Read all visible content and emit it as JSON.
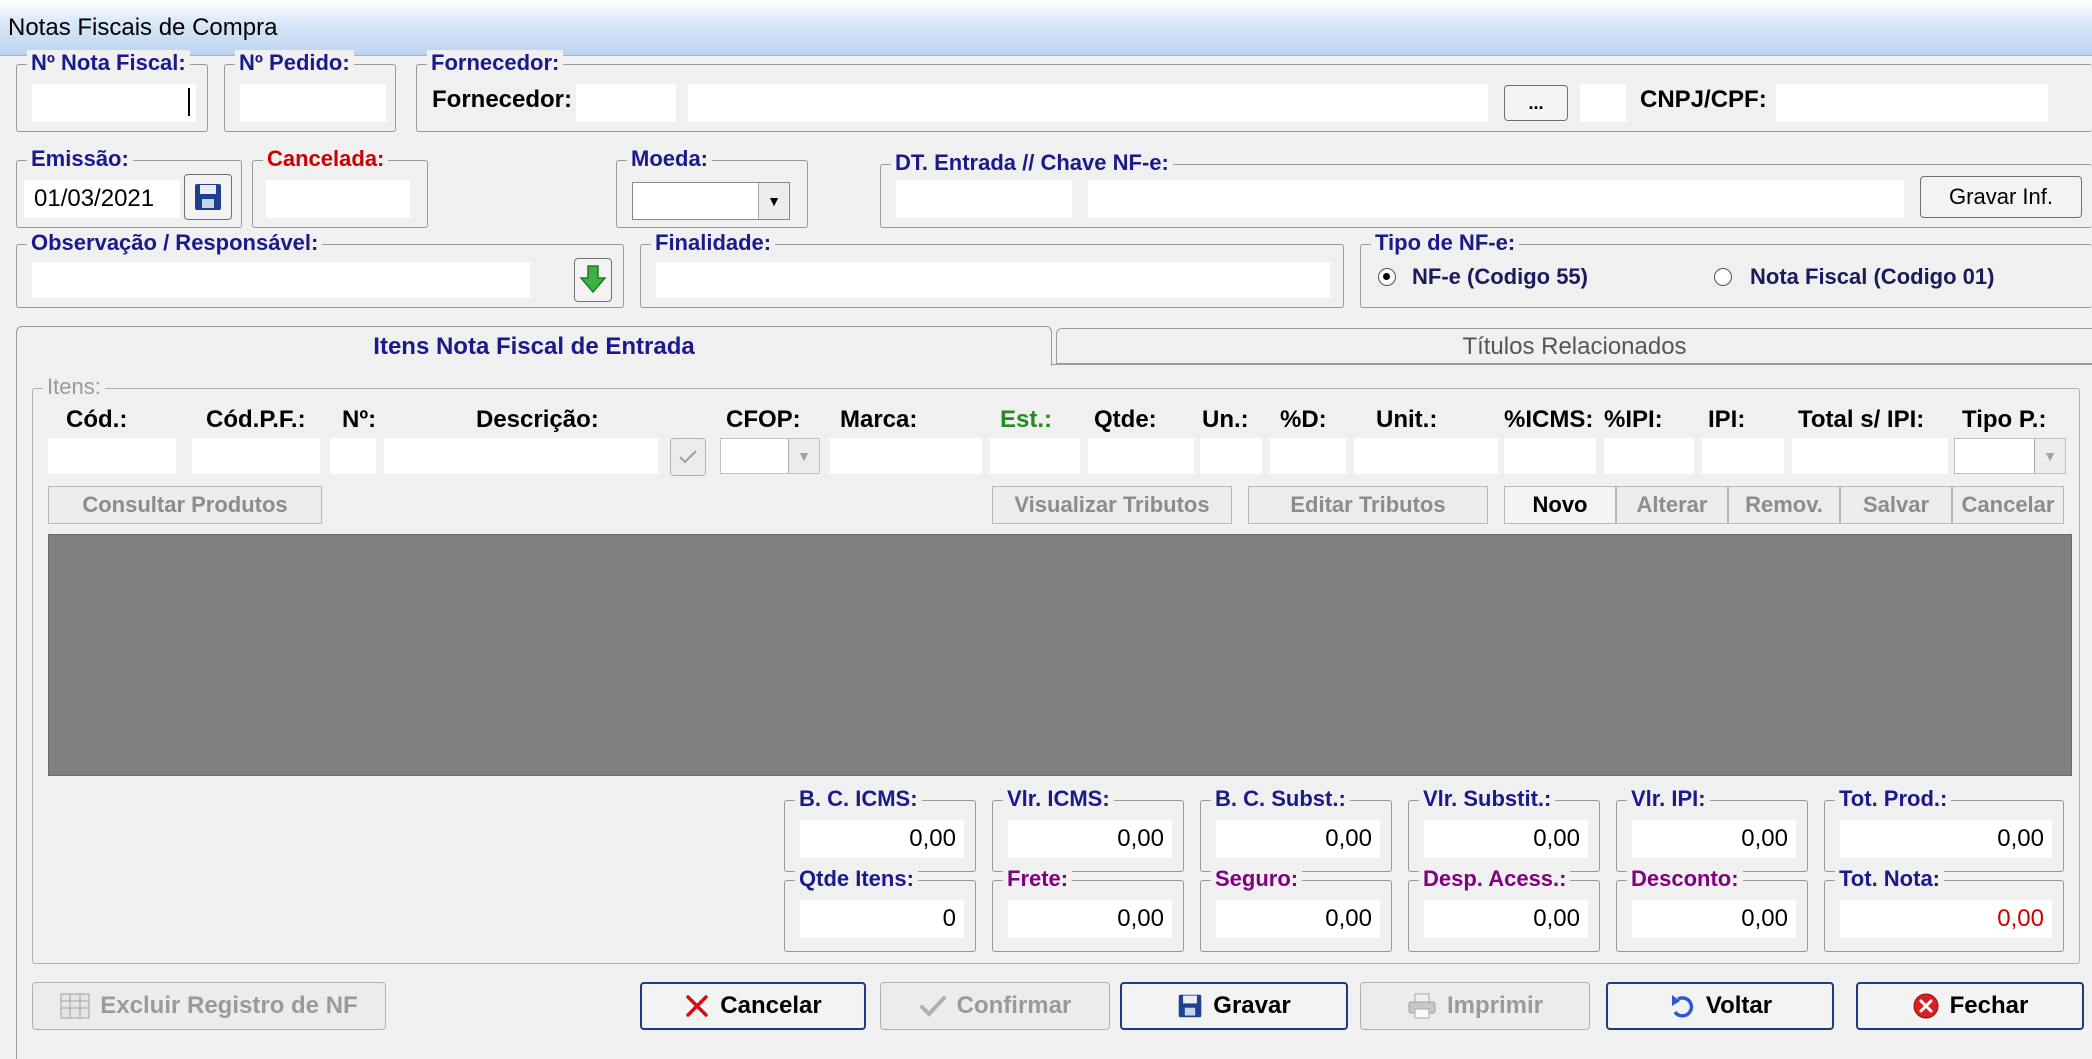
{
  "window": {
    "title": "Notas Fiscais de Compra"
  },
  "header": {
    "nota_fiscal": {
      "legend": "Nº Nota Fiscal:",
      "value": ""
    },
    "pedido": {
      "legend": "Nº Pedido:",
      "value": ""
    },
    "fornecedor": {
      "legend": "Fornecedor:",
      "label": "Fornecedor:",
      "code": "",
      "name": "",
      "browse_label": "...",
      "cnpj_label": "CNPJ/CPF:",
      "cnpj_value": ""
    },
    "emissao": {
      "legend": "Emissão:",
      "value": "01/03/2021"
    },
    "cancelada": {
      "legend": "Cancelada:",
      "value": ""
    },
    "moeda": {
      "legend": "Moeda:",
      "value": ""
    },
    "entrada": {
      "legend": "DT. Entrada // Chave NF-e:",
      "date": "",
      "chave": "",
      "gravar_label": "Gravar Inf."
    },
    "observacao": {
      "legend": "Observação / Responsável:",
      "value": ""
    },
    "finalidade": {
      "legend": "Finalidade:",
      "value": ""
    },
    "tipo_nfe": {
      "legend": "Tipo de NF-e:",
      "opt1": "NF-e (Codigo 55)",
      "opt2": "Nota Fiscal (Codigo 01)",
      "selected": "NF-e (Codigo 55)"
    }
  },
  "tabs": [
    {
      "label": "Itens Nota Fiscal de Entrada",
      "active": true
    },
    {
      "label": "Títulos Relacionados",
      "active": false
    }
  ],
  "items": {
    "legend": "Itens:",
    "columns": [
      "Cód.:",
      "Cód.P.F.:",
      "Nº:",
      "Descrição:",
      "CFOP:",
      "Marca:",
      "Est.:",
      "Qtde:",
      "Un.:",
      "%D:",
      "Unit.:",
      "%ICMS:",
      "%IPI:",
      "IPI:",
      "Total s/ IPI:",
      "Tipo P.:"
    ],
    "buttons": {
      "consultar": "Consultar Produtos",
      "visualizar": "Visualizar Tributos",
      "editar": "Editar Tributos",
      "novo": "Novo",
      "alterar": "Alterar",
      "remover": "Remov.",
      "salvar": "Salvar",
      "cancelar": "Cancelar"
    }
  },
  "totals": {
    "bc_icms": {
      "label": "B. C. ICMS:",
      "value": "0,00"
    },
    "vlr_icms": {
      "label": "Vlr. ICMS:",
      "value": "0,00"
    },
    "bc_subst": {
      "label": "B. C. Subst.:",
      "value": "0,00"
    },
    "vlr_subst": {
      "label": "Vlr. Substit.:",
      "value": "0,00"
    },
    "vlr_ipi": {
      "label": "Vlr. IPI:",
      "value": "0,00"
    },
    "tot_prod": {
      "label": "Tot. Prod.:",
      "value": "0,00"
    },
    "qtde_itens": {
      "label": "Qtde Itens:",
      "value": "0"
    },
    "frete": {
      "label": "Frete:",
      "value": "0,00"
    },
    "seguro": {
      "label": "Seguro:",
      "value": "0,00"
    },
    "desp_acess": {
      "label": "Desp. Acess.:",
      "value": "0,00"
    },
    "desconto": {
      "label": "Desconto:",
      "value": "0,00"
    },
    "tot_nota": {
      "label": "Tot. Nota:",
      "value": "0,00"
    }
  },
  "footer": {
    "excluir": "Excluir Registro de NF",
    "cancelar": "Cancelar",
    "confirmar": "Confirmar",
    "gravar": "Gravar",
    "imprimir": "Imprimir",
    "voltar": "Voltar",
    "fechar": "Fechar"
  },
  "colors": {
    "legend_blue": "#1a1a8c",
    "cancel_red": "#cc0000",
    "est_green": "#228b22",
    "charge_purple": "#800080",
    "grid_grey": "#7f7f7f"
  }
}
